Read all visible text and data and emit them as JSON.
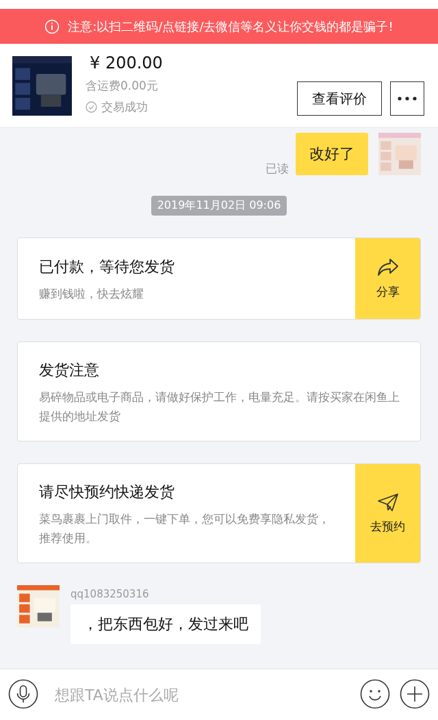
{
  "warning_banner": {
    "text": "注意:以扫二维码/点链接/去微信等名义让你交钱的都是骗子!"
  },
  "order": {
    "price": "¥ 200.00",
    "shipping": "含运费0.00元",
    "status": "交易成功",
    "review_button": "查看评价"
  },
  "messages": [
    {
      "kind": "outgoing",
      "text": "改好了",
      "read_receipt": "已读"
    },
    {
      "kind": "timestamp",
      "text": "2019年11月02日 09:06"
    },
    {
      "kind": "card",
      "title": "已付款，等待您发货",
      "body": "赚到钱啦，快去炫耀",
      "action": "分享"
    },
    {
      "kind": "card",
      "title": "发货注意",
      "body": "易碎物品或电子商品，请做好保护工作，电量充足。请按买家在闲鱼上提供的地址发货"
    },
    {
      "kind": "card",
      "title": "请尽快预约快递发货",
      "body": "菜鸟裹裹上门取件，一键下单，您可以免费享隐私发货，推荐使用。",
      "action": "去预约"
    },
    {
      "kind": "incoming",
      "sender": "qq1083250316",
      "text": "，把东西包好，发过来吧"
    }
  ],
  "composer": {
    "placeholder": "想跟TA说点什么呢"
  }
}
